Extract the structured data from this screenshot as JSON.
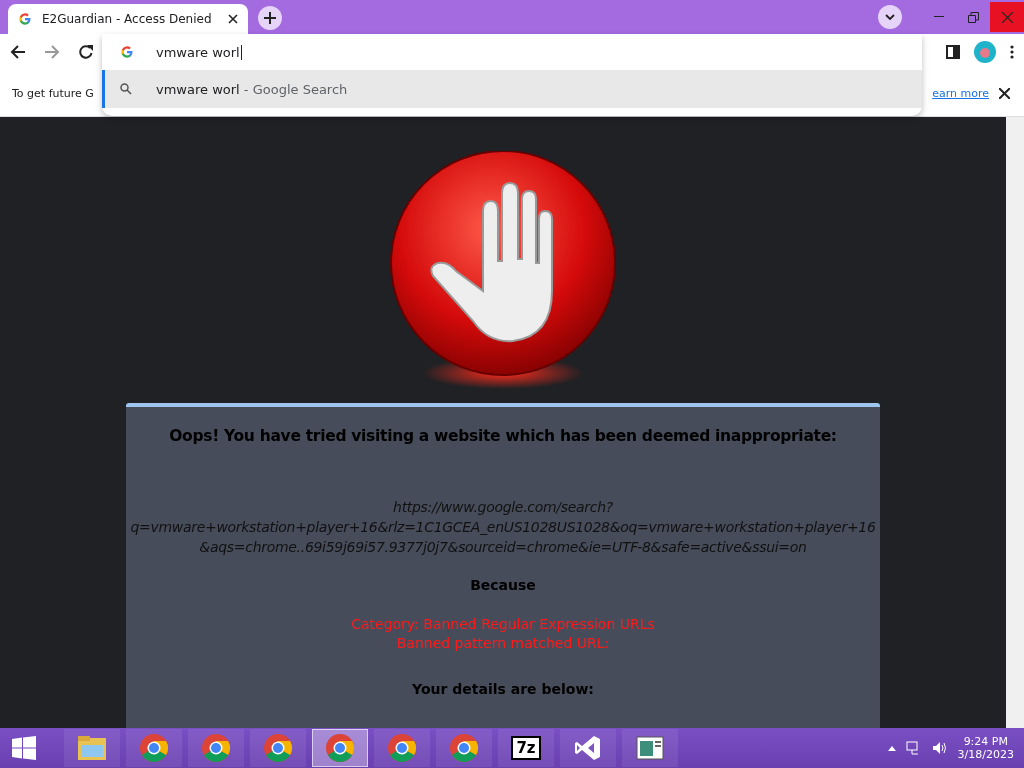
{
  "tab": {
    "title": "E2Guardian - Access Denied",
    "selected": true
  },
  "omnibox": {
    "value": "vmware worl",
    "suggestions": [
      {
        "query": "vmware worl",
        "source": "- Google Search",
        "selected": true
      }
    ]
  },
  "infobar": {
    "text": "To get future G",
    "link": "earn more"
  },
  "page": {
    "heading": "Oops! You have tried visiting a website which has been deemed inappropriate:",
    "url_lines": [
      "https://www.google.com/search?",
      "q=vmware+workstation+player+16&rlz=1C1GCEA_enUS1028US1028&oq=vmware+workstation+player+16",
      "&aqs=chrome..69i59j69i57.9377j0j7&sourceid=chrome&ie=UTF-8&safe=active&ssui=on"
    ],
    "because": "Because",
    "reasons": [
      "Category: Banned Regular Expression URLs",
      "Banned pattern matched URL:"
    ],
    "details": "Your details are below:"
  },
  "taskbar": {
    "items": [
      {
        "kind": "explorer",
        "selected": false
      },
      {
        "kind": "chrome",
        "selected": false
      },
      {
        "kind": "chrome",
        "selected": false
      },
      {
        "kind": "chrome",
        "selected": false
      },
      {
        "kind": "chrome",
        "selected": true
      },
      {
        "kind": "chrome",
        "selected": false
      },
      {
        "kind": "chrome",
        "selected": false
      },
      {
        "kind": "sevenzip",
        "label": "7z",
        "selected": false
      },
      {
        "kind": "vs",
        "selected": false
      },
      {
        "kind": "app",
        "selected": false
      }
    ],
    "time": "9:24 PM",
    "date": "3/18/2023"
  }
}
